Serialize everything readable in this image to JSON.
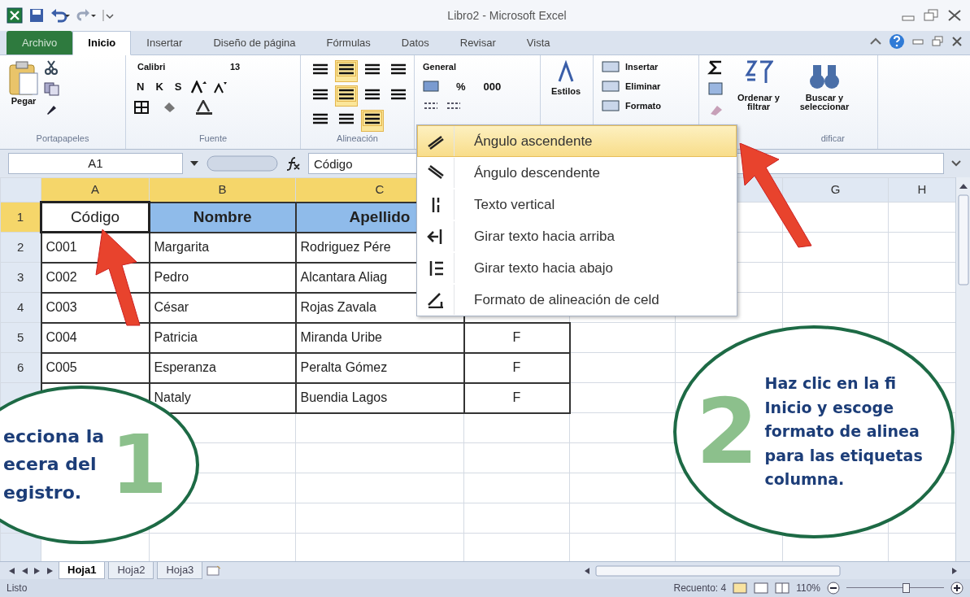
{
  "window": {
    "title": "Libro2 - Microsoft Excel"
  },
  "ribbon_tabs": [
    {
      "label": "Archivo",
      "kind": "file",
      "selected": false
    },
    {
      "label": "Inicio",
      "kind": "tab",
      "selected": true
    },
    {
      "label": "Insertar",
      "kind": "tab",
      "selected": false
    },
    {
      "label": "Diseño de página",
      "kind": "tab",
      "selected": false
    },
    {
      "label": "Fórmulas",
      "kind": "tab",
      "selected": false
    },
    {
      "label": "Datos",
      "kind": "tab",
      "selected": false
    },
    {
      "label": "Revisar",
      "kind": "tab",
      "selected": false
    },
    {
      "label": "Vista",
      "kind": "tab",
      "selected": false
    }
  ],
  "ribbon_groups": [
    {
      "kind": "clipboard",
      "label": "Portapapeles",
      "paste": "Pegar"
    },
    {
      "kind": "font",
      "label": "Fuente",
      "font": "Calibri",
      "size": "13",
      "styles": [
        "N",
        "K",
        "S"
      ]
    },
    {
      "kind": "alignment",
      "label": "Alineación",
      "buttons": [
        {
          "on": false
        },
        {
          "on": true
        },
        {
          "on": false
        },
        {
          "on": false
        },
        {
          "on": false
        },
        {
          "on": true
        },
        {
          "on": false
        },
        {
          "on": false
        },
        {
          "on": false
        },
        {
          "on": false
        },
        {
          "on": true
        }
      ]
    },
    {
      "kind": "number",
      "format": "General",
      "percent": "%",
      "thousands": "000"
    },
    {
      "kind": "styles",
      "styles": "Estilos"
    },
    {
      "kind": "cells",
      "commands": [
        "Insertar",
        "Eliminar",
        "Formato"
      ]
    },
    {
      "kind": "editing",
      "label": "dificar",
      "sort": "Ordenar y filtrar",
      "find": "Buscar y seleccionar"
    }
  ],
  "formula_bar": {
    "name_box": "A1",
    "formula": "Código"
  },
  "sheet": {
    "columns": [
      {
        "label": "A",
        "selected": true
      },
      {
        "label": "B",
        "selected": true
      },
      {
        "label": "C",
        "selected": true
      },
      null,
      null,
      null,
      {
        "label": "G",
        "selected": false
      },
      {
        "label": "H",
        "selected": false
      }
    ],
    "rows": [
      {
        "number": "1",
        "selected": true,
        "kind": "header",
        "cells": [
          {
            "text": "Código",
            "active": true
          },
          {
            "text": "Nombre",
            "active": false
          },
          {
            "text": "Apellido",
            "active": false
          }
        ]
      },
      {
        "number": "2",
        "selected": false,
        "kind": "data",
        "cells": [
          {
            "text": "C001"
          },
          {
            "text": "Margarita"
          },
          {
            "text": "Rodriguez Pére"
          }
        ]
      },
      {
        "number": "3",
        "selected": false,
        "kind": "data",
        "cells": [
          {
            "text": "C002"
          },
          {
            "text": "Pedro"
          },
          {
            "text": "Alcantara Aliag"
          }
        ]
      },
      {
        "number": "4",
        "selected": false,
        "kind": "data",
        "cells": [
          {
            "text": "C003"
          },
          {
            "text": "César"
          },
          {
            "text": "Rojas Zavala"
          }
        ]
      },
      {
        "number": "5",
        "selected": false,
        "kind": "data",
        "cells": [
          {
            "text": "C004"
          },
          {
            "text": "Patricia"
          },
          {
            "text": "Miranda Uribe"
          },
          {
            "text": "F"
          }
        ]
      },
      {
        "number": "6",
        "selected": false,
        "kind": "data",
        "cells": [
          {
            "text": "C005"
          },
          {
            "text": "Esperanza"
          },
          {
            "text": "Peralta Gómez"
          },
          {
            "text": "F"
          }
        ]
      },
      {
        "kind": "data",
        "cells": [
          null,
          {
            "text": "Nataly"
          },
          {
            "text": "Buendia Lagos"
          },
          {
            "text": "F"
          }
        ]
      }
    ]
  },
  "orientation_menu": [
    {
      "label": "Ángulo ascendente",
      "selected": true
    },
    {
      "label": "Ángulo descendente",
      "selected": false
    },
    {
      "label": "Texto vertical",
      "selected": false
    },
    {
      "label": "Girar texto hacia arriba",
      "selected": false
    },
    {
      "label": "Girar texto hacia abajo",
      "selected": false
    },
    {
      "label": "Formato de alineación de celd",
      "selected": false
    }
  ],
  "callouts": [
    {
      "number": "1",
      "lines": [
        "ecciona la",
        "ecera del",
        "egistro."
      ]
    },
    {
      "number": "2",
      "lines": [
        "Haz clic en la fi",
        "Inicio y escoge",
        "formato de alinea",
        "para las etiquetas",
        "columna."
      ]
    }
  ],
  "sheet_tabs": [
    {
      "label": "Hoja1",
      "selected": true
    },
    {
      "label": "Hoja2",
      "selected": false
    },
    {
      "label": "Hoja3",
      "selected": false
    }
  ],
  "status_bar": {
    "state": "Listo",
    "count": "Recuento: 4",
    "zoom": "110%",
    "zoom_slider": {
      "level": 0.62
    }
  }
}
